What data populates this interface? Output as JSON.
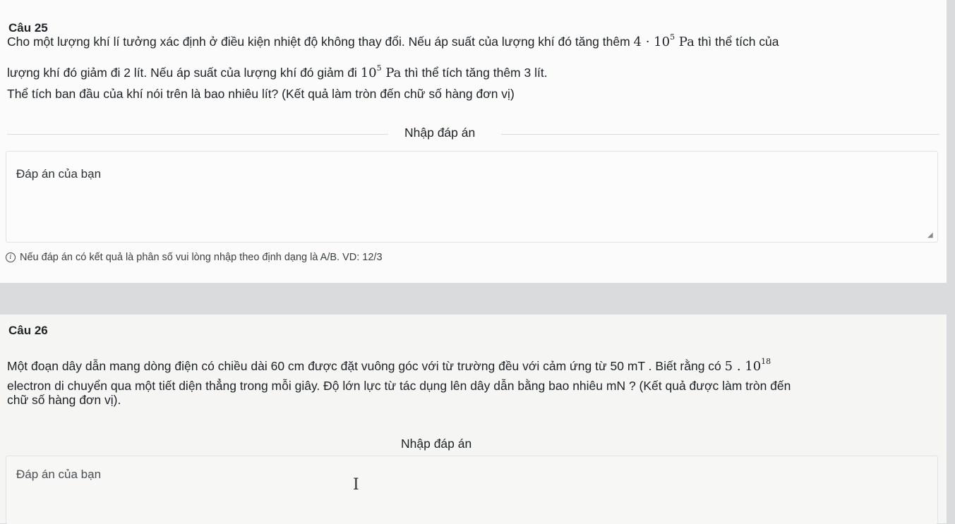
{
  "q25": {
    "title": "Câu 25",
    "line1_a": "Cho một lượng khí lí tưởng xác định ở điều kiện nhiệt độ không thay đổi. Nếu áp suất của lượng khí đó tăng thêm ",
    "line1_math_base": "4 · 10",
    "line1_math_exp": "5",
    "line1_math_unit": " Pa",
    "line1_b": " thì thể tích của",
    "line2_a": "lượng khí đó giảm đi 2 lít. Nếu áp suất của lượng khí đó giảm đi ",
    "line2_math_base": "10",
    "line2_math_exp": "5",
    "line2_math_unit": " Pa",
    "line2_b": " thì thể tích tăng thêm 3 lít.",
    "line3": "Thể tích ban đầu của khí nói trên là bao nhiêu lít? (Kết quả làm tròn đến chữ số hàng đơn vị)",
    "enter_label": "Nhập đáp án",
    "answer_placeholder": "Đáp án của bạn",
    "answer_value": "",
    "hint": "Nếu đáp án có kết quả là phân số vui lòng nhập theo định dạng là A/B. VD: 12/3"
  },
  "q26": {
    "title": "Câu 26",
    "line1_a": "Một đoạn dây dẫn mang dòng điện có chiều dài 60 cm được đặt vuông góc với từ trường đều với cảm ứng từ 50 mT . Biết rằng có ",
    "line1_math_base": "5 . 10",
    "line1_math_exp": "18",
    "line2": "electron di chuyển qua một tiết diện thẳng trong mỗi giây. Độ lớn lực từ tác dụng lên dây dẫn bằng bao nhiêu mN ? (Kết quả được làm tròn đến",
    "line3": "chữ số hàng đơn vị).",
    "enter_label": "Nhập đáp án",
    "answer_placeholder": "Đáp án của bạn",
    "answer_value": ""
  },
  "icons": {
    "info": "info-icon",
    "resize": "resize-handle-icon",
    "cursor": "text-cursor-icon"
  }
}
